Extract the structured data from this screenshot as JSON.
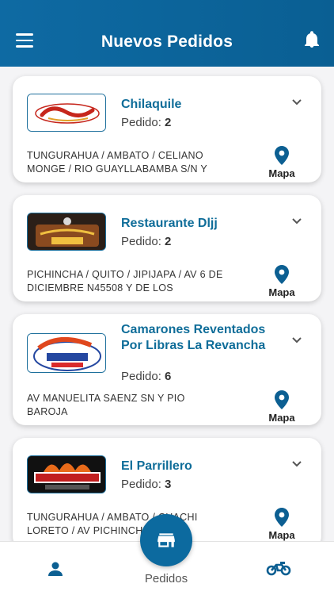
{
  "header": {
    "title": "Nuevos Pedidos",
    "menu_icon": "hamburger-menu-icon",
    "bell_icon": "bell-icon"
  },
  "pedido_label": "Pedido:",
  "mapa_label": "Mapa",
  "orders": [
    {
      "name": "Chilaquile",
      "pedido": "2",
      "address": "TUNGURAHUA / AMBATO / CELIANO MONGE / RIO GUAYLLABAMBA S/N Y"
    },
    {
      "name": "Restaurante Dljj",
      "pedido": "2",
      "address": "PICHINCHA / QUITO / JIPIJAPA / AV 6 DE DICIEMBRE N45508 Y DE LOS"
    },
    {
      "name": "Camarones Reventados Por Libras La Revancha",
      "pedido": "6",
      "address": "AV MANUELITA SAENZ SN Y PIO BAROJA"
    },
    {
      "name": "El Parrillero",
      "pedido": "3",
      "address": "TUNGURAHUA / AMBATO / CHACHI LORETO / AV PICHINCHA"
    }
  ],
  "tabbar": {
    "center_label": "Pedidos"
  },
  "colors": {
    "primary": "#0c6a9f",
    "name_text": "#0f6d99"
  }
}
